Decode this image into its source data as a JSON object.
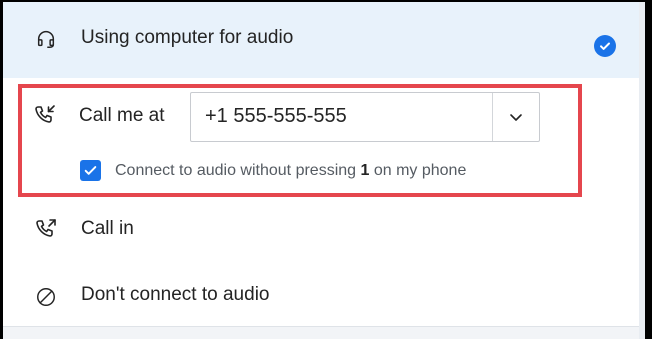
{
  "options": {
    "computer_audio": {
      "label": "Using computer for audio",
      "selected": true,
      "icon": "headset-icon"
    },
    "call_me": {
      "label": "Call me at",
      "icon": "phone-outgoing-icon",
      "phone_number": "+1 555-555-555",
      "auto_connect": {
        "checked": true,
        "text_before": "Connect to audio without pressing ",
        "key": "1",
        "text_after": " on my phone"
      }
    },
    "call_in": {
      "label": "Call in",
      "icon": "phone-incoming-icon"
    },
    "dont_connect": {
      "label": "Don't connect to audio",
      "icon": "prohibited-icon"
    }
  },
  "colors": {
    "selected_row_bg": "#e8f2fb",
    "accent_blue": "#1a73e8",
    "highlight_border": "#e5464d"
  }
}
